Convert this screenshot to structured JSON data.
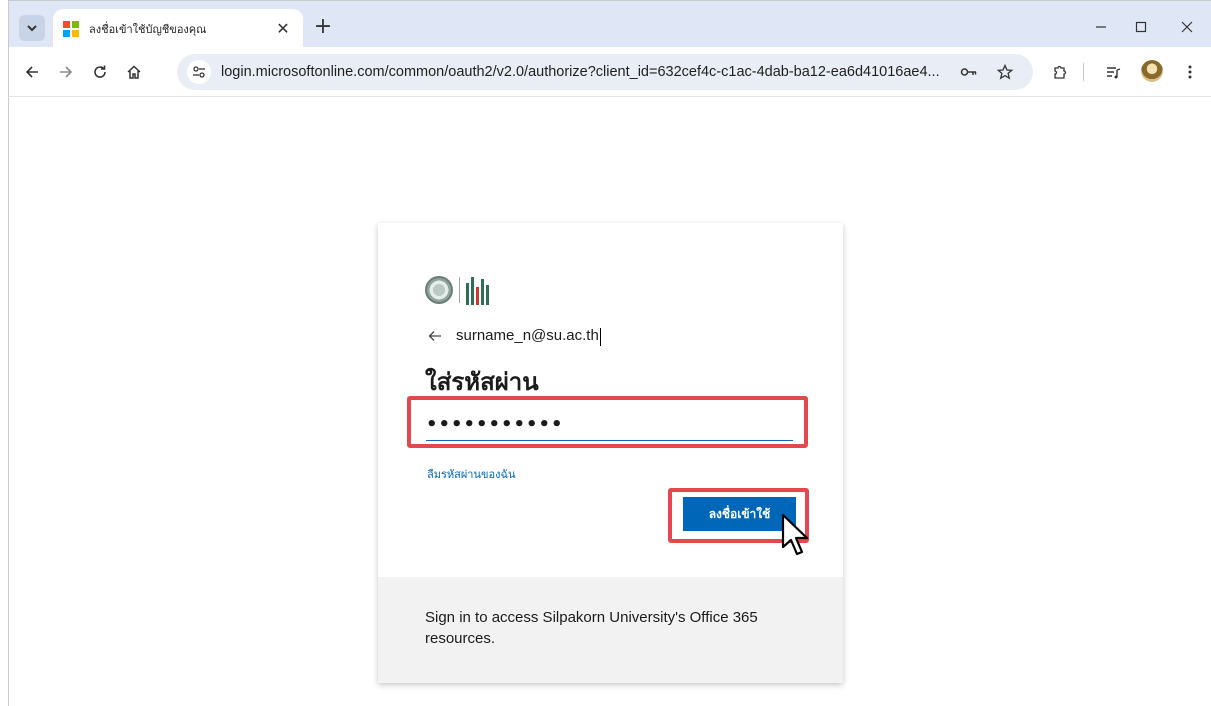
{
  "browser": {
    "tab": {
      "title": "ลงชื่อเข้าใช้บัญชีของคุณ"
    },
    "url": "login.microsoftonline.com/common/oauth2/v2.0/authorize?client_id=632cef4c-c1ac-4dab-ba12-ea6d41016ae4...",
    "icons": {
      "tab_search": "chevron-down-icon",
      "back": "back-arrow-icon",
      "forward": "forward-arrow-icon",
      "reload": "reload-icon",
      "home": "home-icon",
      "site_info": "tune-icon",
      "password": "key-icon",
      "bookmark": "star-icon",
      "extensions": "puzzle-icon",
      "media": "media-control-icon",
      "menu": "kebab-menu-icon"
    }
  },
  "signin": {
    "email": "surname_n@su.ac.th",
    "heading": "ใส่รหัสผ่าน",
    "password_value": "•••••••••••",
    "forgot_link": "ลืมรหัสผ่านของฉัน",
    "submit_label": "ลงชื่อเข้าใช้",
    "footer_text": "Sign in to access Silpakorn University's Office 365 resources."
  },
  "colors": {
    "accent": "#0067b8",
    "highlight": "#e4474c",
    "footer_bg": "#f2f2f2",
    "tabstrip_bg": "#dfe6f5"
  }
}
